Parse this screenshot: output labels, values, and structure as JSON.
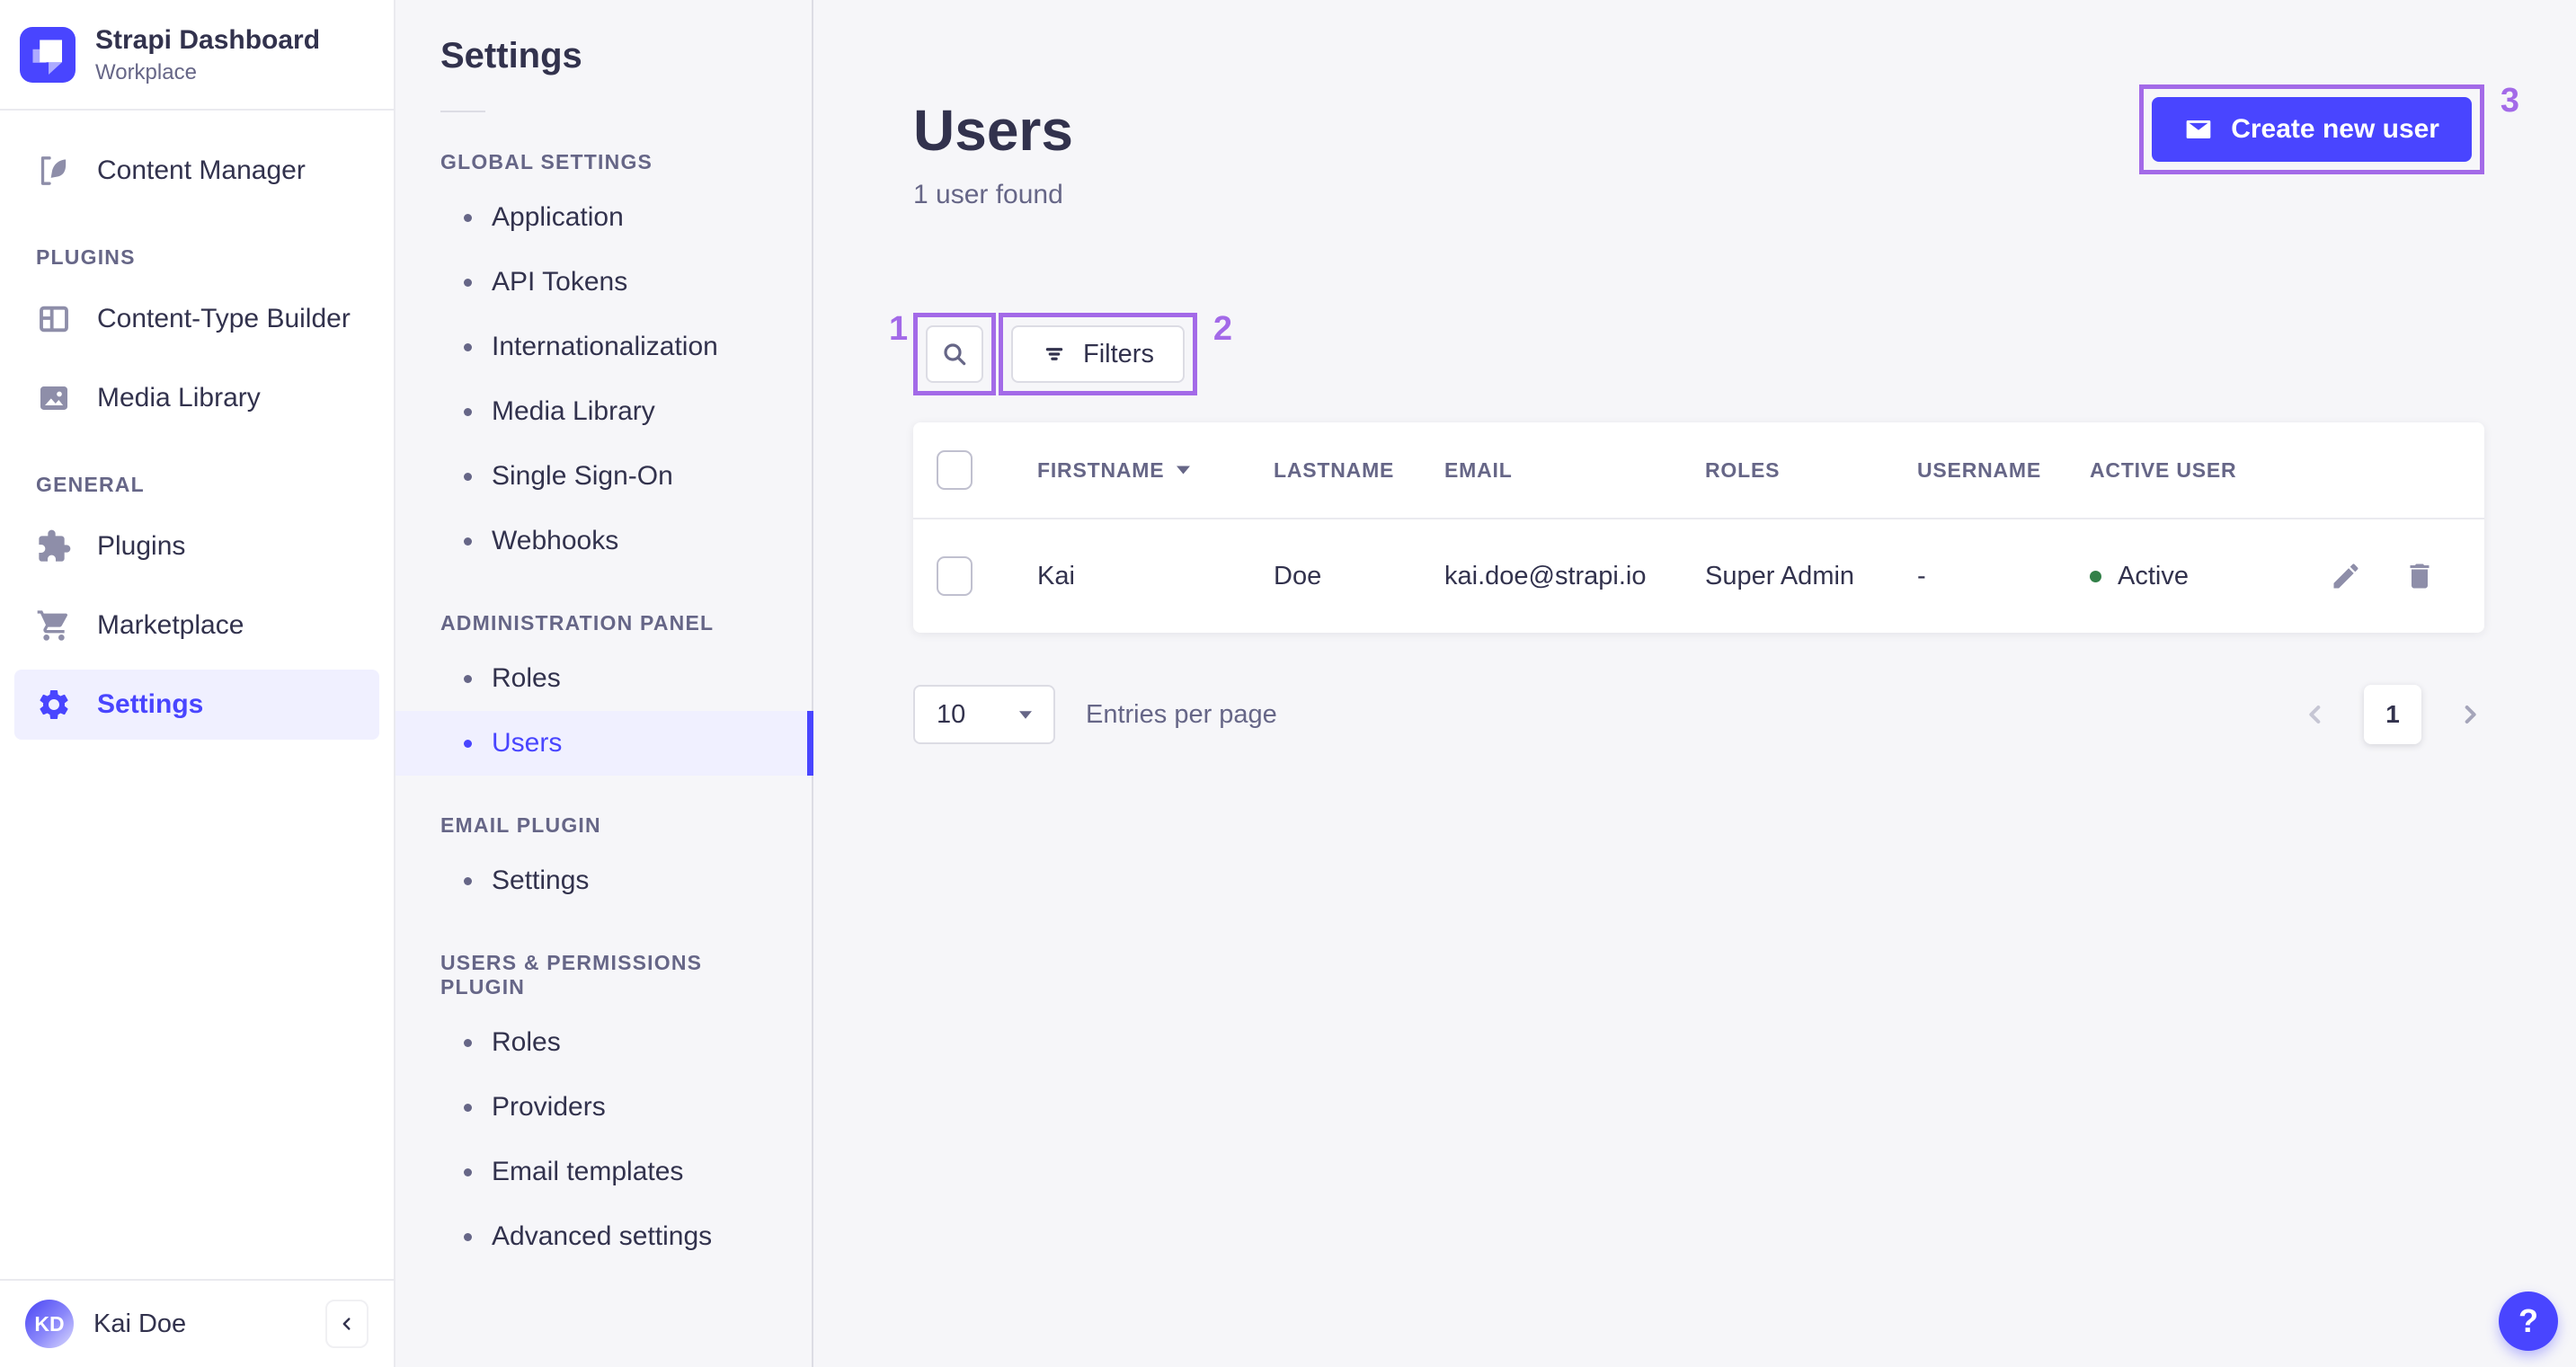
{
  "brand": {
    "title": "Strapi Dashboard",
    "subtitle": "Workplace"
  },
  "sidebar": {
    "content_manager": "Content Manager",
    "sections": [
      {
        "label": "PLUGINS",
        "items": [
          "Content-Type Builder",
          "Media Library"
        ]
      },
      {
        "label": "GENERAL",
        "items": [
          "Plugins",
          "Marketplace",
          "Settings"
        ]
      }
    ],
    "user": {
      "initials": "KD",
      "name": "Kai Doe"
    }
  },
  "settings_nav": {
    "title": "Settings",
    "sections": [
      {
        "label": "GLOBAL SETTINGS",
        "items": [
          "Application",
          "API Tokens",
          "Internationalization",
          "Media Library",
          "Single Sign-On",
          "Webhooks"
        ]
      },
      {
        "label": "ADMINISTRATION PANEL",
        "items": [
          "Roles",
          "Users"
        ]
      },
      {
        "label": "EMAIL PLUGIN",
        "items": [
          "Settings"
        ]
      },
      {
        "label": "USERS & PERMISSIONS PLUGIN",
        "items": [
          "Roles",
          "Providers",
          "Email templates",
          "Advanced settings"
        ]
      }
    ],
    "active_item": "Users"
  },
  "main": {
    "title": "Users",
    "subtitle": "1 user found",
    "create_button": "Create new user",
    "filters_button": "Filters",
    "annotations": {
      "one": "1",
      "two": "2",
      "three": "3"
    },
    "table": {
      "headers": [
        "FIRSTNAME",
        "LASTNAME",
        "EMAIL",
        "ROLES",
        "USERNAME",
        "ACTIVE USER"
      ],
      "rows": [
        {
          "firstname": "Kai",
          "lastname": "Doe",
          "email": "kai.doe@strapi.io",
          "roles": "Super Admin",
          "username": "-",
          "status": "Active"
        }
      ]
    },
    "pagination": {
      "page_size": "10",
      "entries_label": "Entries per page",
      "current_page": "1"
    }
  },
  "help": {
    "label": "?"
  },
  "colors": {
    "primary": "#4945FF",
    "annotation": "#A36AE8",
    "active_status": "#328048",
    "page_background": "#F6F6F9"
  }
}
